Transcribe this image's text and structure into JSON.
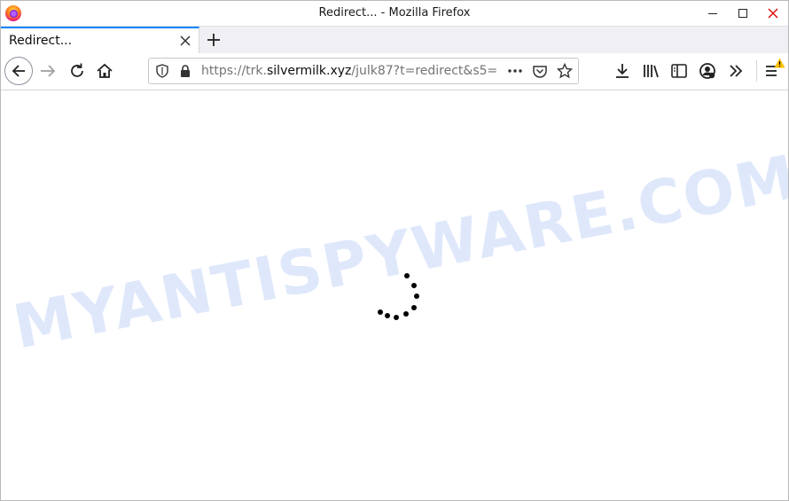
{
  "window": {
    "title": "Redirect... - Mozilla Firefox"
  },
  "tabs": [
    {
      "label": "Redirect...",
      "active": true
    }
  ],
  "navbar": {
    "url_prefix": "https://trk.",
    "url_domain": "silvermilk.xyz",
    "url_suffix": "/julk87?t=redirect&s5="
  },
  "content": {
    "watermark": "MYANTISPYWARE.COM",
    "state": "loading"
  },
  "colors": {
    "tab_accent": "#0a84ff",
    "watermark": "#dfe8fb",
    "warning_badge": "#ffbf00"
  }
}
